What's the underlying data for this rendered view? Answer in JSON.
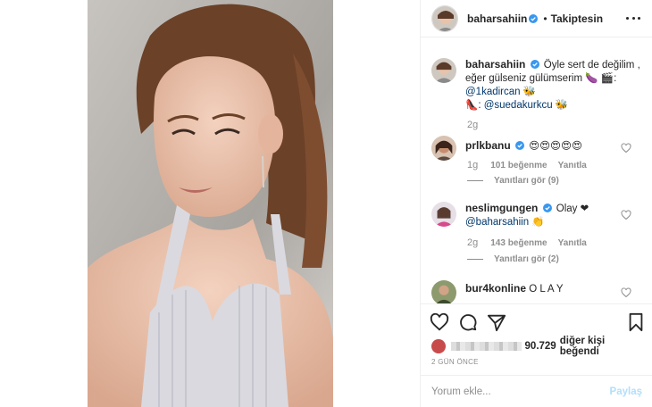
{
  "post": {
    "author": "baharsahiin",
    "follow_status": "Takiptesin",
    "separator": "•",
    "caption": {
      "text_line1": "Öyle sert de değilim ,",
      "text_line2": "eğer gülseniz gülümserim",
      "emoji_line1": "🍆 🎬:",
      "mention1": "@1kadircan",
      "emoji_after_mention1": "🐝",
      "emoji_before_mention2": "👠:",
      "mention2": "@suedakurkcu",
      "emoji_after_mention2": "🐝",
      "time": "2g"
    }
  },
  "comments": [
    {
      "user": "prlkbanu",
      "text": "😍😍😍😍😍",
      "time": "1g",
      "likes": "101 beğenme",
      "reply": "Yanıtla",
      "view_replies": "Yanıtları gör (9)"
    },
    {
      "user": "neslimgungen",
      "text": "Olay ❤",
      "mention": "@baharsahiin",
      "emoji": "👏",
      "time": "2g",
      "likes": "143 beğenme",
      "reply": "Yanıtla",
      "view_replies": "Yanıtları gör (2)"
    },
    {
      "user": "bur4konline",
      "text": "O L A Y"
    }
  ],
  "likes": {
    "count": "90.729",
    "rest": "diğer kişi beğendi"
  },
  "time_ago": "2 GÜN ÖNCE",
  "comment_box": {
    "placeholder": "Yorum ekle...",
    "post_label": "Paylaş"
  },
  "colors": {
    "verified": "#3897f0",
    "mention": "#00376b",
    "muted": "#8e8e8e",
    "post_disabled": "#b2dffc"
  },
  "icons": [
    "heart-icon",
    "comment-icon",
    "share-icon",
    "bookmark-icon",
    "more-icon",
    "verified-icon"
  ]
}
